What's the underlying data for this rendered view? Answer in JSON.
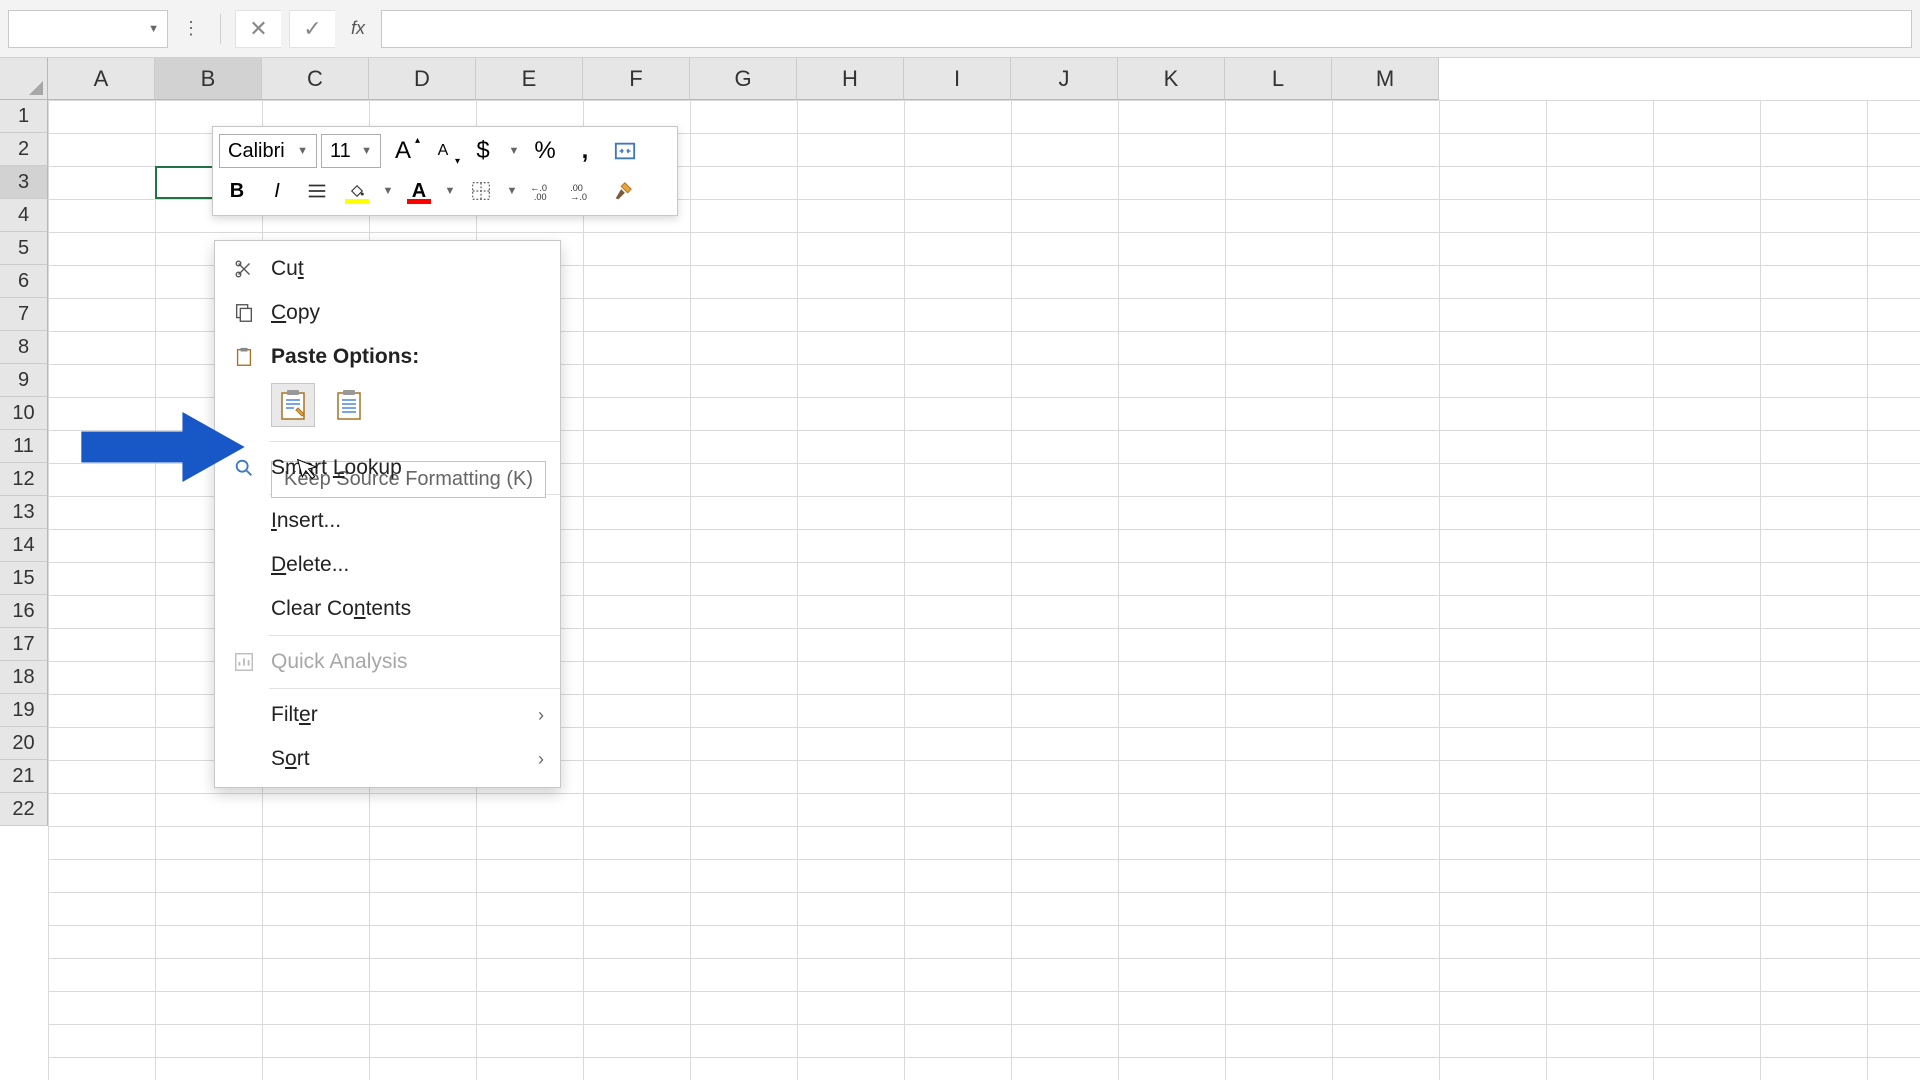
{
  "formula_bar": {
    "name_box_value": "",
    "cancel_title": "Cancel",
    "confirm_title": "Enter",
    "fx_label": "fx"
  },
  "columns": [
    "A",
    "B",
    "C",
    "D",
    "E",
    "F",
    "G",
    "H",
    "I",
    "J",
    "K",
    "L",
    "M"
  ],
  "rows": [
    "1",
    "2",
    "3",
    "4",
    "5",
    "6",
    "7",
    "8",
    "9",
    "10",
    "11",
    "12",
    "13",
    "14",
    "15",
    "16",
    "17",
    "18",
    "19",
    "20",
    "21",
    "22"
  ],
  "selected_col_index": 1,
  "selected_row_index": 2,
  "mini_toolbar": {
    "font_name": "Calibri",
    "font_size": "11",
    "increase_font": "A",
    "decrease_font": "A",
    "currency": "$",
    "percent": "%",
    "comma": ",",
    "bold": "B",
    "italic": "I",
    "font_color_letter": "A"
  },
  "context_menu": {
    "cut": "Cut",
    "copy": "Copy",
    "paste_options_header": "Paste Options:",
    "tooltip": "Keep Source Formatting (K)",
    "smart_lookup": "Smart Lookup",
    "insert": "Insert...",
    "delete": "Delete...",
    "clear_contents": "Clear Contents",
    "quick_analysis": "Quick Analysis",
    "filter": "Filter",
    "sort": "Sort"
  },
  "colors": {
    "excel_green": "#217346",
    "arrow_blue": "#1858c6"
  }
}
